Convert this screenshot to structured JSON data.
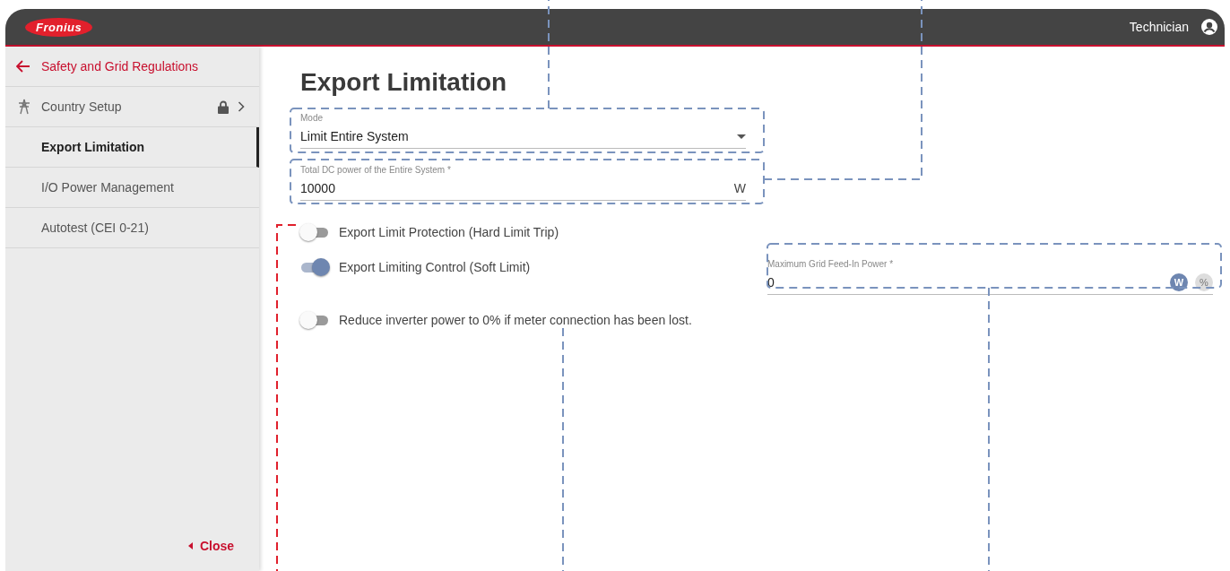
{
  "header": {
    "logo": "Fronius",
    "user": "Technician"
  },
  "sidebar": {
    "back": "Safety and Grid Regulations",
    "items": [
      {
        "label": "Country Setup",
        "kind": "submenu",
        "locked": true,
        "selected": false
      },
      {
        "label": "Export Limitation",
        "kind": "page",
        "locked": false,
        "selected": true
      },
      {
        "label": "I/O Power Management",
        "kind": "page",
        "locked": false,
        "selected": false
      },
      {
        "label": "Autotest (CEI 0-21)",
        "kind": "page",
        "locked": false,
        "selected": false
      }
    ],
    "close": "Close"
  },
  "main": {
    "title": "Export Limitation",
    "fields": [
      {
        "kind": "select",
        "label": "Mode",
        "value": "Limit Entire System"
      },
      {
        "kind": "number",
        "label": "Total DC power of the Entire System *",
        "value": "10000",
        "unit": "W"
      }
    ],
    "toggles": [
      {
        "label": "Export Limit Protection (Hard Limit Trip)",
        "on": false
      },
      {
        "label": "Export Limiting Control (Soft Limit)",
        "on": true,
        "field": {
          "label": "Maximum Grid Feed-In Power *",
          "value": "0",
          "units": [
            {
              "label": "W",
              "selected": true
            },
            {
              "label": "%",
              "selected": false
            }
          ]
        }
      },
      {
        "label": "Reduce inverter power to 0% if meter connection has been lost.",
        "on": false
      }
    ]
  }
}
